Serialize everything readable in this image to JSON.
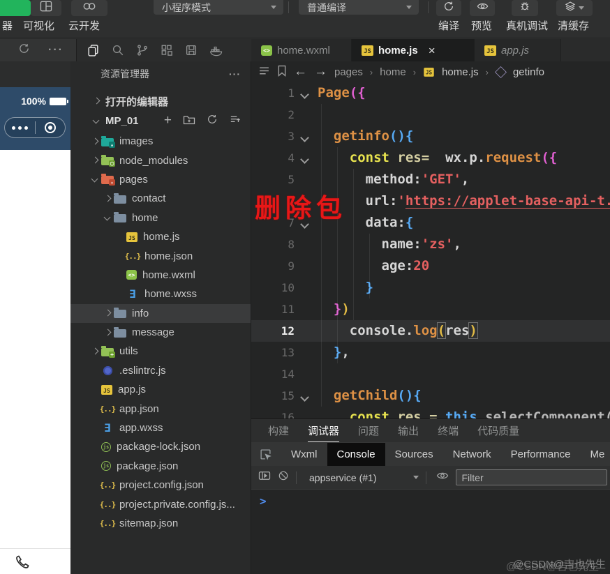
{
  "topbar": {
    "simulator_label": "器",
    "visual_label": "可视化",
    "cloud_label": "云开发",
    "mode_dropdown": "小程序模式",
    "compile_dropdown": "普通编译",
    "compile_label": "编译",
    "preview_label": "预览",
    "device_debug_label": "真机调试",
    "clear_cache_label": "清缓存",
    "accent_green": "#22b45c"
  },
  "simulator": {
    "battery": "100%"
  },
  "explorer": {
    "title": "资源管理器",
    "more_icon": "···",
    "open_editors": "打开的编辑器",
    "project": "MP_01",
    "tree": [
      {
        "label": "images",
        "icon": "folder f-images",
        "indent": 0,
        "chevron": "right"
      },
      {
        "label": "node_modules",
        "icon": "folder f-node",
        "indent": 0,
        "chevron": "right"
      },
      {
        "label": "pages",
        "icon": "folder f-pages",
        "indent": 0,
        "chevron": "down"
      },
      {
        "label": "contact",
        "icon": "folder f-gray",
        "indent": 1,
        "chevron": "right"
      },
      {
        "label": "home",
        "icon": "folder f-gray",
        "indent": 1,
        "chevron": "down"
      },
      {
        "label": "home.js",
        "icon": "js",
        "indent": 2,
        "chevron": "none"
      },
      {
        "label": "home.json",
        "icon": "json",
        "indent": 2,
        "chevron": "none"
      },
      {
        "label": "home.wxml",
        "icon": "wxml",
        "indent": 2,
        "chevron": "none"
      },
      {
        "label": "home.wxss",
        "icon": "wxss",
        "indent": 2,
        "chevron": "none"
      },
      {
        "label": "info",
        "icon": "folder f-gray",
        "indent": 1,
        "chevron": "right",
        "selected": true
      },
      {
        "label": "message",
        "icon": "folder f-gray",
        "indent": 1,
        "chevron": "right"
      },
      {
        "label": "utils",
        "icon": "folder f-utils",
        "indent": 0,
        "chevron": "right"
      },
      {
        "label": ".eslintrc.js",
        "icon": "eslint",
        "indent": 0,
        "chevron": "none"
      },
      {
        "label": "app.js",
        "icon": "js",
        "indent": 0,
        "chevron": "none"
      },
      {
        "label": "app.json",
        "icon": "json",
        "indent": 0,
        "chevron": "none"
      },
      {
        "label": "app.wxss",
        "icon": "wxss",
        "indent": 0,
        "chevron": "none"
      },
      {
        "label": "package-lock.json",
        "icon": "npm",
        "indent": 0,
        "chevron": "none"
      },
      {
        "label": "package.json",
        "icon": "npm",
        "indent": 0,
        "chevron": "none"
      },
      {
        "label": "project.config.json",
        "icon": "json",
        "indent": 0,
        "chevron": "none"
      },
      {
        "label": "project.private.config.js...",
        "icon": "json",
        "indent": 0,
        "chevron": "none"
      },
      {
        "label": "sitemap.json",
        "icon": "json",
        "indent": 0,
        "chevron": "none"
      }
    ]
  },
  "tabs": [
    {
      "label": "home.wxml",
      "icon": "wxml",
      "active": false
    },
    {
      "label": "home.js",
      "icon": "js",
      "active": true,
      "close": "×"
    },
    {
      "label": "app.js",
      "icon": "js",
      "active": false,
      "preview": true
    }
  ],
  "breadcrumb": {
    "items": [
      "pages",
      "home",
      "home.js",
      "getinfo"
    ]
  },
  "editor": {
    "annotation": "删除包",
    "lines": [
      {
        "n": 1,
        "pad": 0,
        "fold": true,
        "tokens": [
          {
            "t": "Page",
            "c": "or"
          },
          {
            "t": "({",
            "c": "pk"
          }
        ]
      },
      {
        "n": 2,
        "pad": 0,
        "tokens": []
      },
      {
        "n": 3,
        "pad": 2,
        "fold": true,
        "tokens": [
          {
            "t": "getinfo",
            "c": "or"
          },
          {
            "t": "(){",
            "c": "bl"
          }
        ]
      },
      {
        "n": 4,
        "pad": 4,
        "fold": true,
        "tokens": [
          {
            "t": "const",
            "c": "yl"
          },
          {
            "t": " ",
            "c": "wh"
          },
          {
            "t": "res=",
            "c": "pl"
          },
          {
            "t": "  ",
            "c": "wh"
          },
          {
            "t": "wx.p.",
            "c": "wh"
          },
          {
            "t": "request",
            "c": "or"
          },
          {
            "t": "({",
            "c": "pk"
          }
        ]
      },
      {
        "n": 5,
        "pad": 6,
        "tokens": [
          {
            "t": "method",
            "c": "wh"
          },
          {
            "t": ":",
            "c": "wh"
          },
          {
            "t": "'GET'",
            "c": "rd"
          },
          {
            "t": ",",
            "c": "wh"
          }
        ]
      },
      {
        "n": 6,
        "pad": 6,
        "hideNum": true,
        "tokens": [
          {
            "t": "url",
            "c": "wh"
          },
          {
            "t": ":",
            "c": "wh"
          },
          {
            "t": "'",
            "c": "rd"
          },
          {
            "t": "https://applet-base-api-t.i",
            "c": "rd lk"
          }
        ]
      },
      {
        "n": 7,
        "pad": 6,
        "fold": true,
        "tokens": [
          {
            "t": "data",
            "c": "wh"
          },
          {
            "t": ":",
            "c": "wh"
          },
          {
            "t": "{",
            "c": "bl"
          }
        ]
      },
      {
        "n": 8,
        "pad": 8,
        "tokens": [
          {
            "t": "name",
            "c": "wh"
          },
          {
            "t": ":",
            "c": "wh"
          },
          {
            "t": "'zs'",
            "c": "rd"
          },
          {
            "t": ",",
            "c": "wh"
          }
        ]
      },
      {
        "n": 9,
        "pad": 8,
        "tokens": [
          {
            "t": "age",
            "c": "wh"
          },
          {
            "t": ":",
            "c": "wh"
          },
          {
            "t": "20",
            "c": "rd"
          }
        ]
      },
      {
        "n": 10,
        "pad": 6,
        "tokens": [
          {
            "t": "}",
            "c": "bl"
          }
        ]
      },
      {
        "n": 11,
        "pad": 2,
        "tokens": [
          {
            "t": "}",
            "c": "pk"
          },
          {
            "t": ")",
            "c": "gold"
          }
        ]
      },
      {
        "n": 12,
        "pad": 4,
        "current": true,
        "tokens": [
          {
            "t": "console",
            "c": "wh"
          },
          {
            "t": ".",
            "c": "wh"
          },
          {
            "t": "log",
            "c": "or"
          },
          {
            "t": "(",
            "c": "gold bx"
          },
          {
            "t": "res",
            "c": "wh"
          },
          {
            "t": ")",
            "c": "gold bx"
          }
        ]
      },
      {
        "n": 13,
        "pad": 2,
        "tokens": [
          {
            "t": "}",
            "c": "bl"
          },
          {
            "t": ",",
            "c": "wh"
          }
        ]
      },
      {
        "n": 14,
        "pad": 0,
        "tokens": []
      },
      {
        "n": 15,
        "pad": 2,
        "fold": true,
        "tokens": [
          {
            "t": "getChild",
            "c": "or"
          },
          {
            "t": "(){",
            "c": "bl"
          }
        ]
      },
      {
        "n": 16,
        "pad": 4,
        "tokens": [
          {
            "t": "const",
            "c": "yl"
          },
          {
            "t": " res = ",
            "c": "pl"
          },
          {
            "t": "this",
            "c": "bl"
          },
          {
            "t": ".selectComponent(",
            "c": "dim"
          }
        ]
      }
    ]
  },
  "bottom": {
    "panel_tabs": [
      "构建",
      "调试器",
      "问题",
      "输出",
      "终端",
      "代码质量"
    ],
    "panel_active": "调试器",
    "devtools_tabs": [
      "Wxml",
      "Console",
      "Sources",
      "Network",
      "Performance",
      "Me"
    ],
    "devtools_active": "Console",
    "context": "appservice (#1)",
    "filter_placeholder": "Filter",
    "prompt": ">",
    "watermark": "@CSDN@吉也先生"
  }
}
